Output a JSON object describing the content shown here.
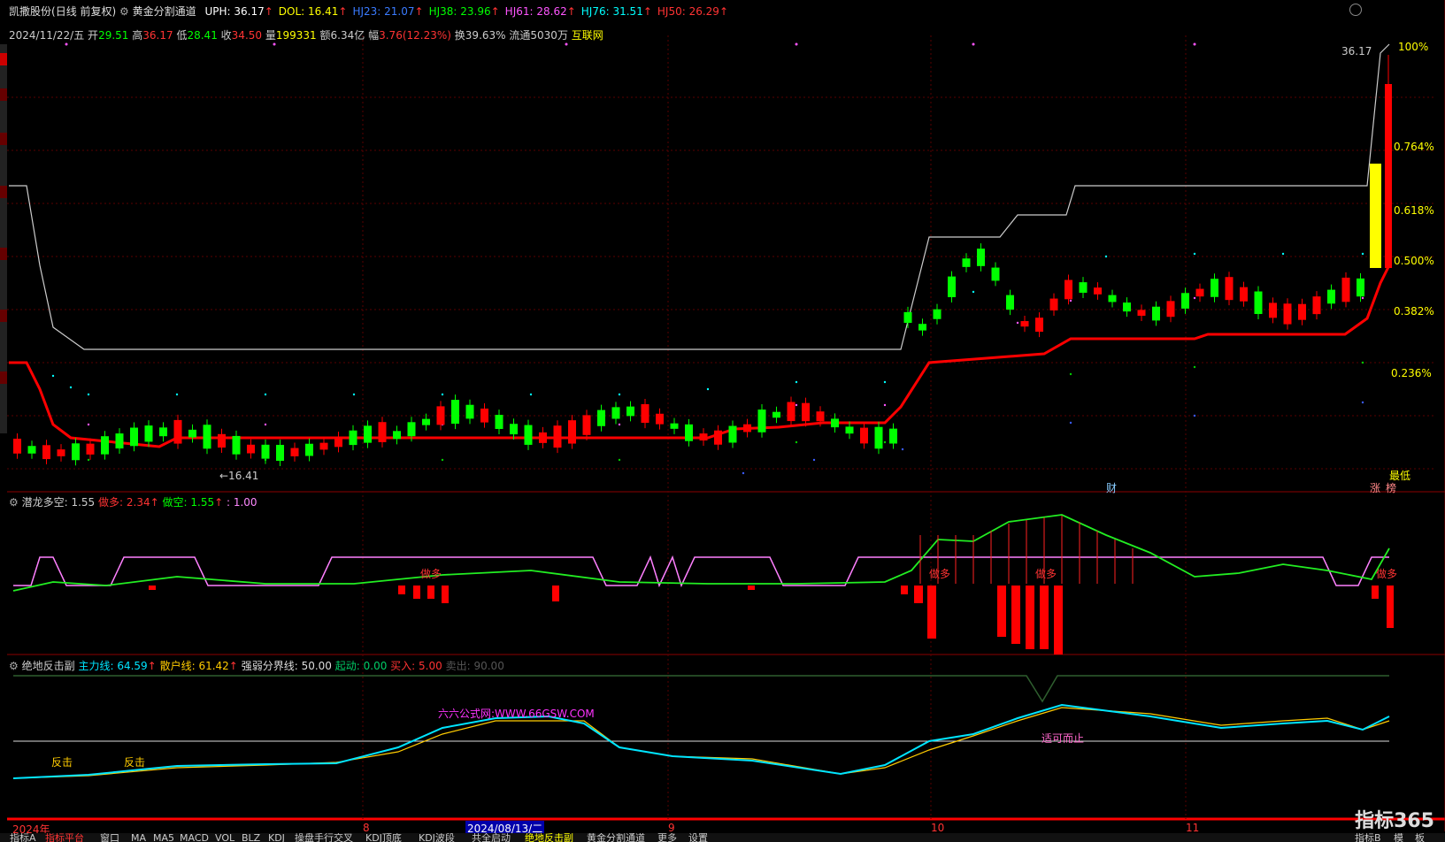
{
  "header": {
    "stock_name": "凯撒股份",
    "mode": "(日线 前复权)",
    "indicator": "黄金分割通道",
    "items": [
      {
        "label": "UPH: 36.17",
        "color": "#ffffff"
      },
      {
        "label": "DOL: 16.41",
        "color": "#ffff00"
      },
      {
        "label": "HJ23: 21.07",
        "color": "#3a7bff"
      },
      {
        "label": "HJ38: 23.96",
        "color": "#00ff00"
      },
      {
        "label": "HJ61: 28.62",
        "color": "#ff55ff"
      },
      {
        "label": "HJ76: 31.51",
        "color": "#00ffff"
      },
      {
        "label": "HJ50: 26.29",
        "color": "#ff3333"
      }
    ]
  },
  "info_bar": {
    "date": "2024/11/22/五",
    "open_label": "开",
    "open": "29.51",
    "high_label": "高",
    "high": "36.17",
    "low_label": "低",
    "low": "28.41",
    "close_label": "收",
    "close": "34.50",
    "vol_label": "量",
    "vol": "199331",
    "amt_label": "额",
    "amt": "6.34亿",
    "chg_label": "幅",
    "chg": "3.76(12.23%)",
    "turnover_label": "换",
    "turnover": "39.63%",
    "float_label": "流通",
    "float": "5030万",
    "link": "互联网"
  },
  "price_panel": {
    "max_label": "36.17",
    "min_label": "←16.41",
    "fib_labels": [
      "100%",
      "0.764%",
      "0.618%",
      "0.500%",
      "0.382%",
      "0.236%"
    ],
    "low_tag": "最低",
    "cai_tag": "财",
    "zhang_tag": "涨",
    "bang_tag": "榜"
  },
  "panel2": {
    "name": "潜龙多空",
    "v0": ": 1.55",
    "v1_label": "做多:",
    "v1": "2.34",
    "v2_label": "做空:",
    "v2": "1.55",
    "v3": ": 1.00",
    "zuoduo": "做多"
  },
  "panel3": {
    "name": "绝地反击副",
    "main_label": "主力线:",
    "main": "64.59",
    "retail_label": "散户线:",
    "retail": "61.42",
    "split_label": "强弱分界线:",
    "split": "50.00",
    "start_label": "起动:",
    "start": "0.00",
    "buy_label": "买入:",
    "buy": "5.00",
    "sell_label": "卖出:",
    "sell": "90.00",
    "watermark": "六六公式网:WWW.66GSW.COM",
    "fanji": "反击",
    "shike": "适可而止"
  },
  "time_axis": {
    "labels": [
      "2024年",
      "8",
      "2024/08/13/二",
      "9",
      "10",
      "11"
    ]
  },
  "tabs": [
    "指标A",
    "指标平台",
    "窗口",
    "MA",
    "MA5",
    "MACD",
    "VOL",
    "BLZ",
    "KDJ",
    "操盘手行交叉",
    "KDJ顶底",
    "KDJ波段",
    "共全启动",
    "绝地反击副",
    "黄金分割通道",
    "更多",
    "设置",
    "指标B",
    "模",
    "板"
  ],
  "logo": "指标365"
}
